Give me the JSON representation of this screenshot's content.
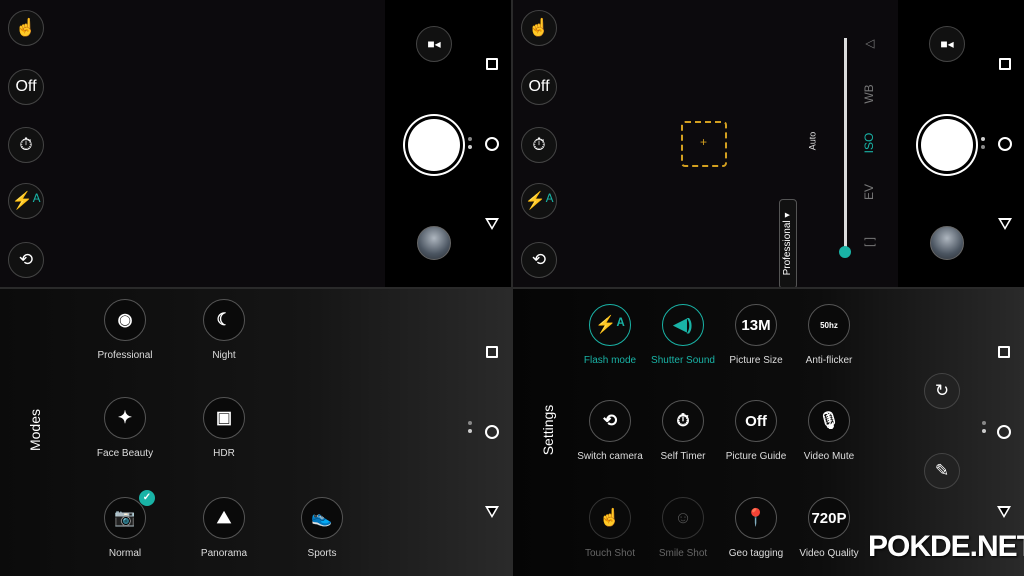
{
  "accent": "#19b3a6",
  "camera": {
    "flash_off": "Off",
    "icons": [
      "touch-shot-icon",
      "off-label",
      "self-timer-icon",
      "flash-auto-icon",
      "switch-camera-icon"
    ]
  },
  "pro": {
    "mode_label": "Professional ▾",
    "value_label": "Auto",
    "params": [
      {
        "symbol": "[ ]",
        "label": "Manual focus"
      },
      {
        "symbol": "EV",
        "label": "Exposure"
      },
      {
        "symbol": "ISO",
        "label": "ISO",
        "active": true
      },
      {
        "symbol": "WB",
        "label": "White balance"
      },
      {
        "symbol": "△",
        "label": "Sharpness"
      }
    ],
    "slider_value": 0
  },
  "modes": {
    "title": "Modes",
    "items": [
      {
        "label": "Professional",
        "icon": "aperture-icon",
        "glyph": "◉"
      },
      {
        "label": "Night",
        "icon": "moon-icon",
        "glyph": "☾"
      },
      {
        "label": "Face Beauty",
        "icon": "magic-wand-icon",
        "glyph": "✦"
      },
      {
        "label": "HDR",
        "icon": "hdr-icon",
        "glyph": "▣"
      },
      {
        "label": "Normal",
        "icon": "camera-icon",
        "glyph": "📷",
        "selected": true
      },
      {
        "label": "Panorama",
        "icon": "panorama-icon",
        "glyph": "⛰"
      },
      {
        "label": "Sports",
        "icon": "shoe-icon",
        "glyph": "👟"
      }
    ]
  },
  "settings": {
    "title": "Settings",
    "items": [
      {
        "label": "Flash mode",
        "glyph": "⚡ᴬ",
        "icon": "flash-auto-icon",
        "state": "active"
      },
      {
        "label": "Shutter Sound",
        "glyph": "◀)",
        "icon": "speaker-icon",
        "state": "active"
      },
      {
        "label": "Picture Size",
        "glyph": "13M",
        "icon": "picture-size-icon"
      },
      {
        "label": "Anti-flicker",
        "glyph": "50hz",
        "icon": "anti-flicker-icon"
      },
      {
        "label": "Switch camera",
        "glyph": "⟲",
        "icon": "switch-camera-icon"
      },
      {
        "label": "Self Timer",
        "glyph": "⏱",
        "icon": "timer-off-icon"
      },
      {
        "label": "Picture Guide",
        "glyph": "Off",
        "icon": "picture-guide-icon"
      },
      {
        "label": "Video Mute",
        "glyph": "🎙",
        "icon": "mic-off-icon"
      },
      {
        "label": "Touch Shot",
        "glyph": "☝",
        "icon": "touch-icon",
        "state": "disabled"
      },
      {
        "label": "Smile Shot",
        "glyph": "☺",
        "icon": "smile-icon",
        "state": "disabled"
      },
      {
        "label": "Geo tagging",
        "glyph": "📍",
        "icon": "location-pin-icon"
      },
      {
        "label": "Video Quality",
        "glyph": "720P",
        "icon": "video-quality-icon"
      }
    ]
  },
  "watermark": "POKDE.NET"
}
